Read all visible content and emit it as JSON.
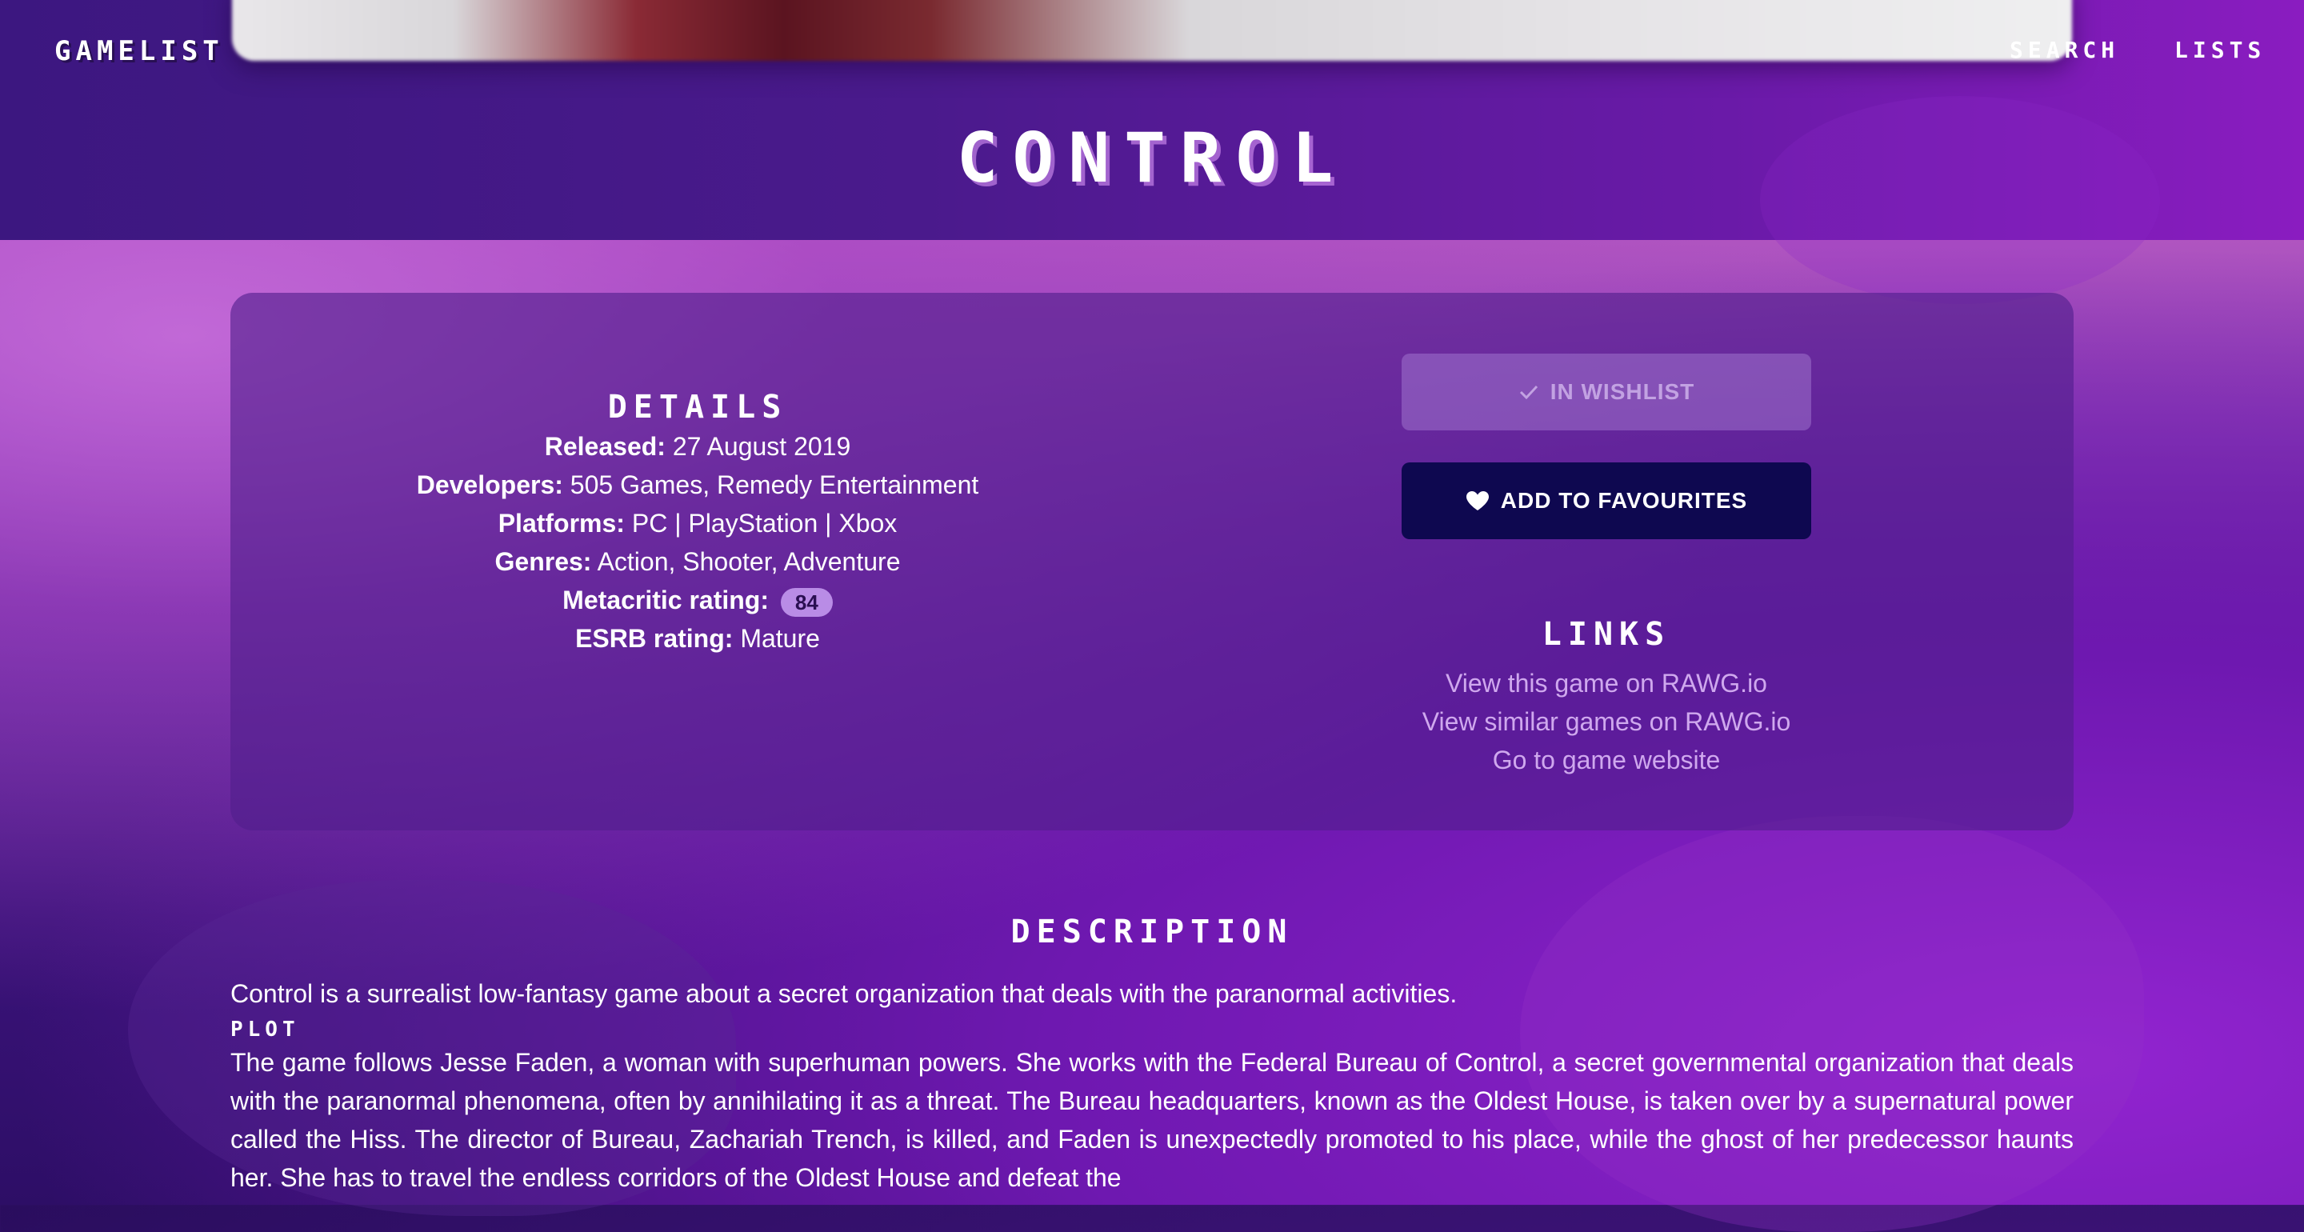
{
  "header": {
    "brand": "GAMELIST",
    "nav": {
      "search": "SEARCH",
      "lists": "LISTS"
    },
    "title": "CONTROL"
  },
  "details": {
    "heading": "DETAILS",
    "released_label": "Released:",
    "released_value": "27 August 2019",
    "developers_label": "Developers:",
    "developers_value": "505 Games, Remedy Entertainment",
    "platforms_label": "Platforms:",
    "platforms_value": "PC | PlayStation | Xbox",
    "genres_label": "Genres:",
    "genres_value": "Action, Shooter, Adventure",
    "metacritic_label": "Metacritic rating:",
    "metacritic_value": "84",
    "esrb_label": "ESRB rating:",
    "esrb_value": "Mature"
  },
  "actions": {
    "wishlist_label": "IN WISHLIST",
    "favourites_label": "ADD TO FAVOURITES"
  },
  "links": {
    "heading": "LINKS",
    "items": [
      "View this game on RAWG.io",
      "View similar games on RAWG.io",
      "Go to game website"
    ]
  },
  "description": {
    "heading": "DESCRIPTION",
    "intro": "Control is a surrealist low-fantasy game about a secret organization that deals with the paranormal activities.",
    "plot_label": "PLOT",
    "plot": "The game follows Jesse Faden, a woman with superhuman powers. She works with the Federal Bureau of Control, a secret governmental organization that deals with the paranormal phenomena, often by annihilating it as a threat. The Bureau headquarters, known as the Oldest House, is taken over by a supernatural power called the Hiss. The director of Bureau, Zachariah Trench, is killed, and Faden is unexpectedly promoted to his place, while the ghost of her predecessor haunts her. She has to travel the endless corridors of the Oldest House and defeat the"
  },
  "colors": {
    "accent": "#0e0850",
    "badge": "#b98ce6",
    "link": "#cfa8ee"
  }
}
